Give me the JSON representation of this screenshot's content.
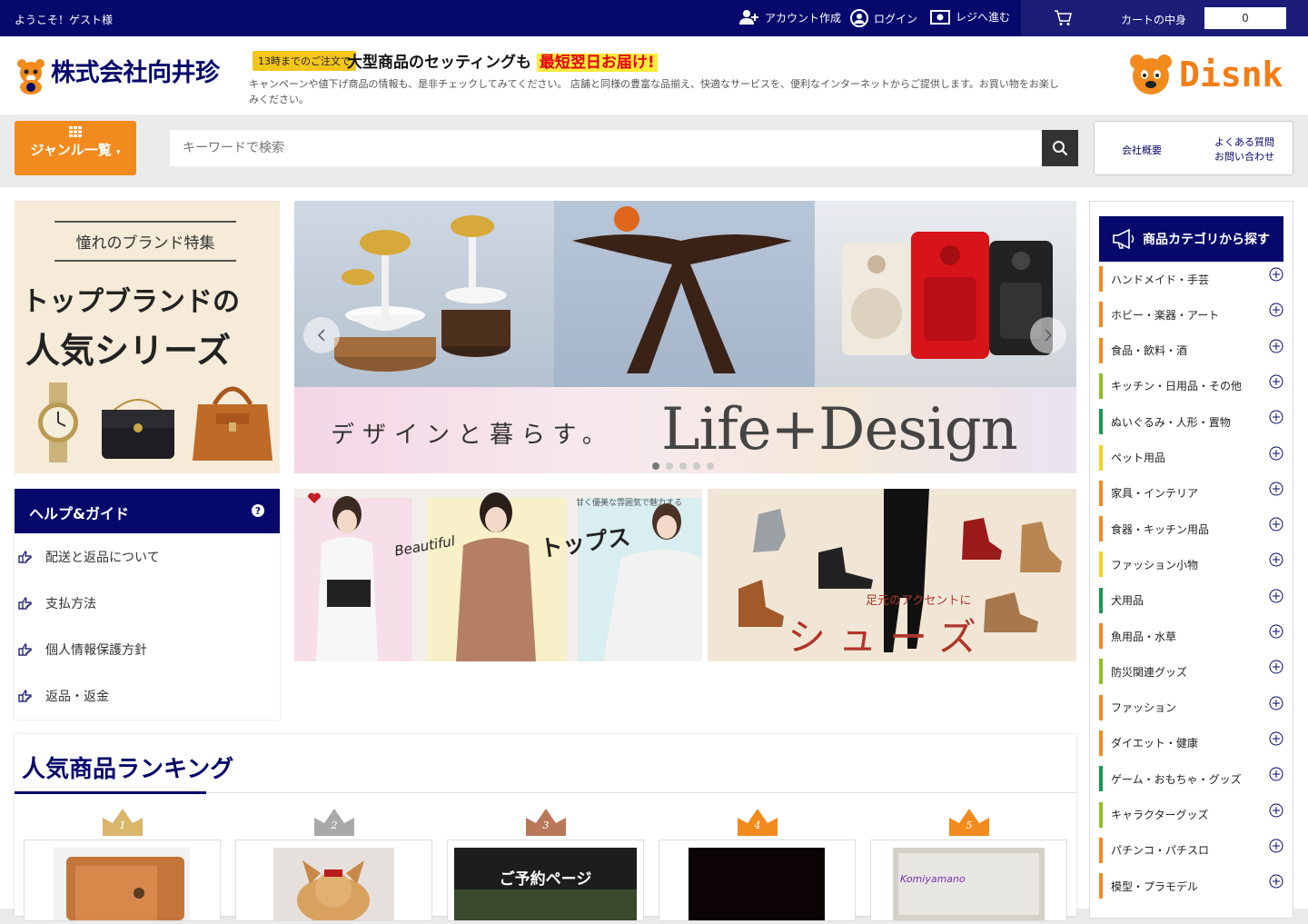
{
  "topbar": {
    "welcome": "ようこそ！ゲスト様",
    "create_account": "アカウント作成",
    "login": "ログイン",
    "checkout": "レジへ進む",
    "cart_label": "カートの中身",
    "cart_count": "0"
  },
  "header": {
    "company_name": "株式会社向井珍",
    "promo_tag": "13時までのご注文で",
    "promo_head": "大型商品のセッティングも",
    "promo_highlight": "最短翌日お届け!",
    "promo_desc": "キャンペーンや値下げ商品の情報も、是非チェックしてみてください。 店舗と同様の豊富な品揃え、快適なサービスを、便利なインターネットからご提供します。お買い物をお楽しみください。",
    "brand_logo": "Disnk"
  },
  "nav": {
    "genre_button": "ジャンル一覧",
    "search_placeholder": "キーワードで検索",
    "company_link": "会社概要",
    "faq_link": "よくある質問",
    "contact_link": "お問い合わせ"
  },
  "brand_banner": {
    "top": "憧れのブランド特集",
    "line1": "トップブランドの",
    "line2": "人気シリーズ"
  },
  "slider": {
    "sub": "デザインと暮らす。",
    "main": "Life+Design"
  },
  "help": {
    "title": "ヘルプ&ガイド",
    "items": [
      "配送と返品について",
      "支払方法",
      "個人情報保護方針",
      "返品・返金"
    ]
  },
  "fashion_banner": {
    "word1": "Beautiful",
    "word2": "トップス",
    "small": "甘く優美な雰囲気で魅力する"
  },
  "shoes_banner": {
    "sub": "足元のアクセントに",
    "main": "シューズ"
  },
  "ranking": {
    "title": "人気商品ランキング",
    "ranks": [
      "1",
      "2",
      "3",
      "4",
      "5"
    ],
    "card3_text": "ご予約ページ",
    "card5_text": "Komiyamano"
  },
  "categories": {
    "title": "商品カテゴリから探す",
    "items": [
      "ハンドメイド・手芸",
      "ホビー・楽器・アート",
      "食品・飲料・酒",
      "キッチン・日用品・その他",
      "ぬいぐるみ・人形・置物",
      "ペット用品",
      "家具・インテリア",
      "食器・キッチン用品",
      "ファッション小物",
      "犬用品",
      "魚用品・水草",
      "防災関連グッズ",
      "ファッション",
      "ダイエット・健康",
      "ゲーム・おもちゃ・グッズ",
      "キャラクターグッズ",
      "パチンコ・パチスロ",
      "模型・プラモデル"
    ]
  },
  "colors": {
    "primary": "#06086b",
    "accent": "#f28b1e",
    "cat_border_a": "#f28b1e",
    "cat_border_b": "#8dc21f",
    "cat_border_c": "#1a9a4e",
    "cat_border_d": "#f4d21f"
  }
}
